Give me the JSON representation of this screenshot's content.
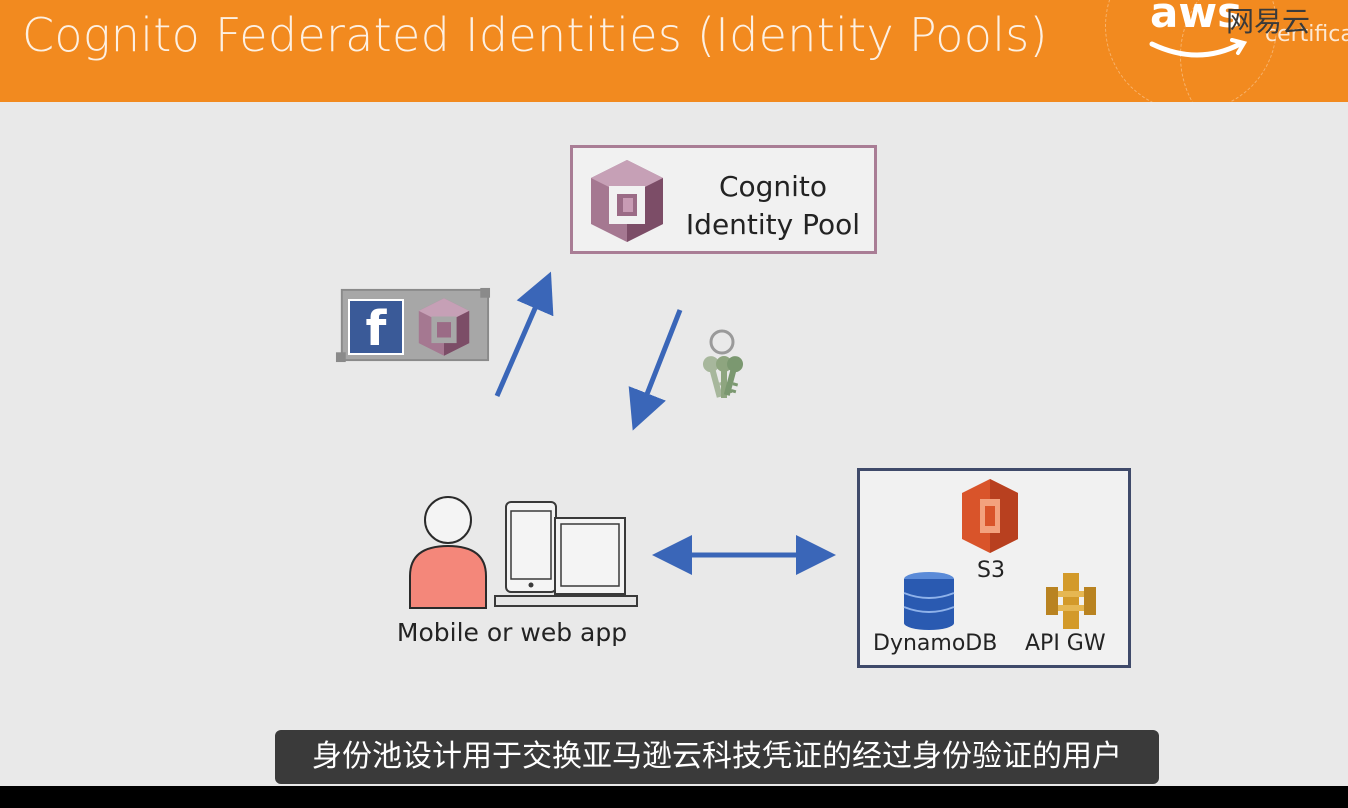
{
  "header": {
    "title": "Cognito Federated Identities (Identity Pools)",
    "logo_text": "aws",
    "watermark": "网易云",
    "cert_text": "certifica",
    "color": "#f28a1f"
  },
  "diagram": {
    "identity_pool": {
      "line1": "Cognito",
      "line2": "Identity Pool",
      "icon": "cognito-icon",
      "border_color": "#a97d95"
    },
    "token": {
      "facebook_glyph": "f",
      "icons": [
        "facebook-icon",
        "cognito-icon"
      ]
    },
    "credentials_icon": "keys-icon",
    "user_app": {
      "label": "Mobile or web app",
      "icons": [
        "person-icon",
        "phone-icon",
        "laptop-icon"
      ]
    },
    "services": {
      "border_color": "#3f4a6a",
      "items": [
        {
          "name": "S3",
          "icon": "s3-icon"
        },
        {
          "name": "DynamoDB",
          "icon": "dynamodb-icon"
        },
        {
          "name": "API GW",
          "icon": "api-gateway-icon"
        }
      ]
    },
    "arrow_color": "#3a66b8"
  },
  "subtitle": {
    "text": "身份池设计用于交换亚马逊云科技凭证的经过身份验证的用户"
  }
}
